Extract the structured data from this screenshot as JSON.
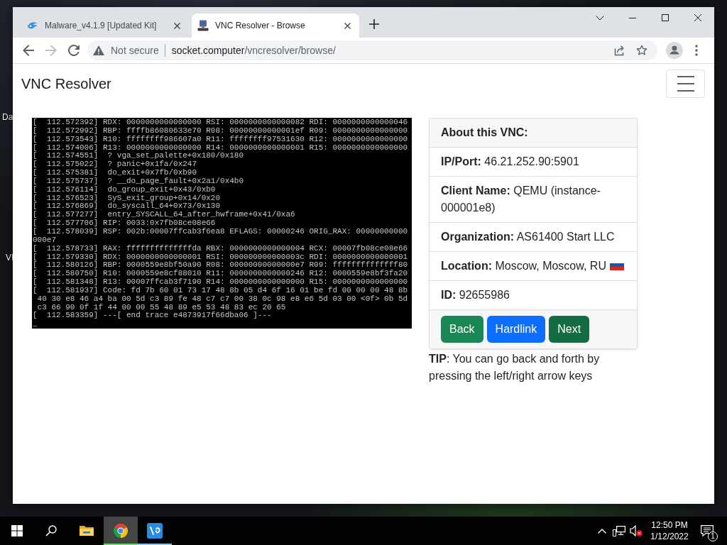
{
  "desktop": {
    "icons": [
      {
        "label": "Da"
      },
      {
        "label": "VI"
      }
    ]
  },
  "browser": {
    "tabs": [
      {
        "kind": "swirl",
        "title": "Malware_v4.1.9 [Updated Kit]",
        "selected": false
      },
      {
        "kind": "computer",
        "title": "VNC Resolver - Browse",
        "selected": true
      }
    ],
    "nav_buttons": [
      {
        "kind": "back",
        "disabled": false
      },
      {
        "kind": "forward",
        "disabled": true
      },
      {
        "kind": "reload",
        "disabled": false
      }
    ],
    "address_bar": {
      "security_label": "Not secure",
      "host": "socket.computer",
      "path": "/vncresolver/browse/"
    }
  },
  "page": {
    "brand": "VNC Resolver",
    "screenshot": {
      "lines": [
        "[  112.572392] RDX: 0000000000000000 RSI: 0000000000000082 RDI: 0000000000000046",
        "[  112.572992] RBP: ffffb86080633e70 R08: 00000000000001ef R09: 0000000000000000",
        "[  112.573543] R10: ffffffff986607a0 R11: ffffffff97531630 R12: 0000000000000000",
        "[  112.574006] R13: 0000000000000000 R14: 0000000000000001 R15: 0000000000000000",
        "[  112.574551]  ? vga_set_palette+0x180/0x180",
        "[  112.575022]  ? panic+0x1fa/0x247",
        "[  112.575381]  do_exit+0x7fb/0xb90",
        "[  112.575737]  ? __do_page_fault+0x2a1/0x4b0",
        "[  112.576114]  do_group_exit+0x43/0xb0",
        "[  112.576523]  SyS_exit_group+0x14/0x20",
        "[  112.576869]  do_syscall_64+0x73/0x130",
        "[  112.577277]  entry_SYSCALL_64_after_hwframe+0x41/0xa6",
        "[  112.577706] RIP: 0033:0x7fb08ce08e66",
        "[  112.578039] RSP: 002b:00007ffcab3f6ea8 EFLAGS: 00000246 ORIG_RAX: 00000000000",
        "000e7",
        "[  112.578733] RAX: ffffffffffffffda RBX: 0000000000000004 RCX: 00007fb08ce08e66",
        "[  112.579330] RDX: 0000000000000001 RSI: 000000000000003c RDI: 0000000000000001",
        "[  112.580126] RBP: 0000559e8bf50a90 R08: 00000000000000e7 R09: ffffffffffffff80",
        "[  112.580750] R10: 0000559e8cf88010 R11: 0000000000000246 R12: 0000559e8bf3fa20",
        "[  112.581348] R13: 00007ffcab3f7190 R14: 0000000000000000 R15: 0000000000000000",
        "[  112.581937] Code: fd 7b 60 01 73 17 48 8b 05 d4 6f 16 01 be fd 00 00 00 48 8b",
        " 40 30 e8 46 a4 ba 00 5d c3 89 fe 48 c7 c7 00 38 0c 98 e8 e6 5d 03 00 <0f> 0b 5d",
        " c3 66 90 0f 1f 44 00 00 55 48 89 e5 53 48 83 ec 20 65",
        "[  112.583359] ---[ end trace e4873917f66dba06 ]---",
        "_"
      ]
    },
    "card": {
      "title": "About this VNC:",
      "fields": [
        {
          "text": "**IP/Port:** 46.21.252.90:5901",
          "flag": false
        },
        {
          "text": "**Client Name:** QEMU (instance-000001e8)",
          "flag": false
        },
        {
          "text": "**Organization:** AS61400 Start LLC",
          "flag": false
        },
        {
          "text": "**Location:** Moscow, Moscow, RU",
          "flag": true
        },
        {
          "text": "**ID:** 92655986",
          "flag": false
        }
      ],
      "buttons": [
        {
          "label": "Back",
          "color": "#198754"
        },
        {
          "label": "Hardlink",
          "color": "#0d6efd"
        },
        {
          "label": "Next",
          "color": "#146c43"
        }
      ]
    },
    "tip": "**TIP**: You can go back and forth by pressing the left/right arrow keys"
  },
  "taskbar": {
    "apps": [
      {
        "kind": "folder",
        "running": false,
        "selected": false
      },
      {
        "kind": "browser",
        "running": true,
        "selected": true
      },
      {
        "kind": "remote",
        "running": true,
        "selected": false
      }
    ],
    "clock": {
      "time": "12:50 PM",
      "date": "1/12/2022"
    },
    "notification_count": "1"
  }
}
